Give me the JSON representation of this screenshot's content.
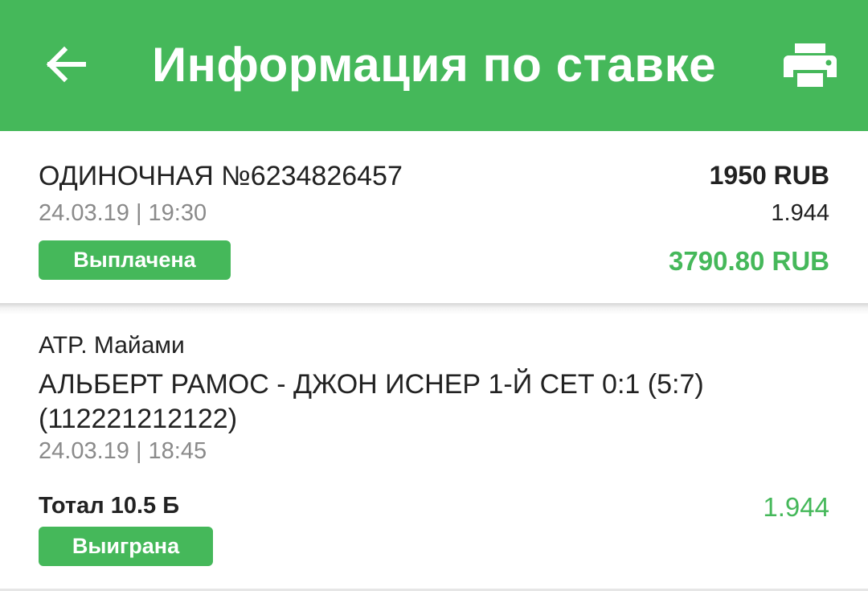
{
  "header": {
    "title": "Информация по ставке",
    "back_icon": "arrow-left-icon",
    "print_icon": "printer-icon",
    "accent_color": "#45b85a"
  },
  "bet": {
    "type_number": "ОДИНОЧНАЯ №6234826457",
    "date_time": "24.03.19 | 19:30",
    "status": "Выплачена",
    "stake": "1950 RUB",
    "coefficient": "1.944",
    "payout": "3790.80 RUB"
  },
  "event": {
    "tournament": "ATP. Майами",
    "name": "АЛЬБЕРТ РАМОС - ДЖОН ИСНЕР 1-Й СЕТ 0:1 (5:7) (112221212122)",
    "date_time": "24.03.19 | 18:45",
    "outcome": "Тотал 10.5 Б",
    "coefficient": "1.944",
    "status": "Выиграна"
  }
}
